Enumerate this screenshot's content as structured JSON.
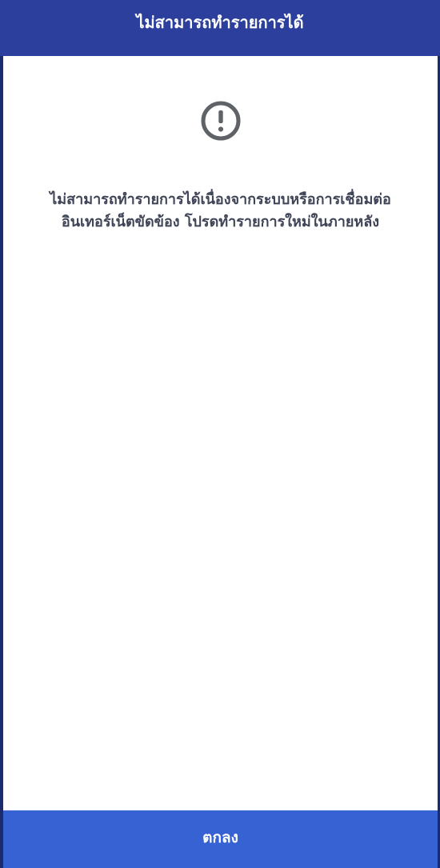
{
  "header": {
    "title": "ไม่สามารถทำรายการได้"
  },
  "alert": {
    "icon": "exclamation-circle-icon",
    "icon_color": "#5f6368",
    "message_lines": [
      "ไม่สามารถทำรายการได้เนื่องจากระบบหรือการเชื่อมต่อ",
      "อินเทอร์เน็ตขัดข้อง โปรดทำรายการใหม่ในภายหลัง"
    ]
  },
  "footer": {
    "ok_label": "ตกลง"
  },
  "colors": {
    "header_background": "#2c3f9c",
    "button_background": "#3762d3",
    "text": "#3f4457"
  }
}
